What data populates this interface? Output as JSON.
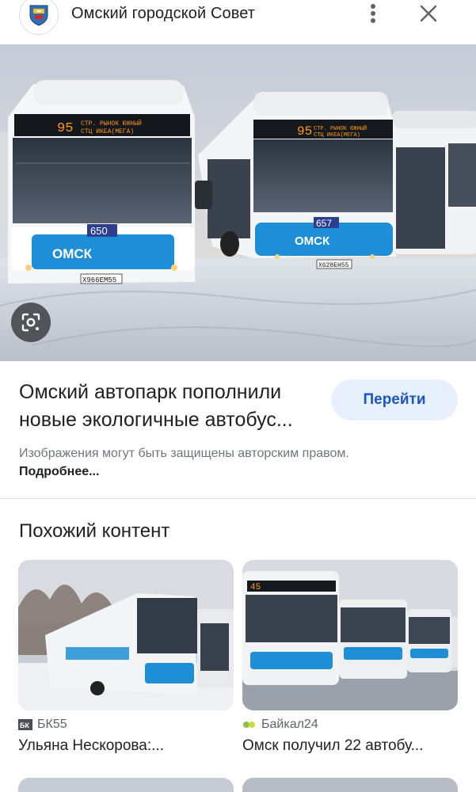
{
  "header": {
    "site_name": "Омский городской Совет",
    "favicon_icon": "omsk-coat-of-arms-icon",
    "menu_icon": "more-vert-icon",
    "close_icon": "close-icon"
  },
  "hero": {
    "lens_icon": "google-lens-icon",
    "bus_left": {
      "route": "95",
      "destination_line1": "СТР. РЫНОК ЮЖНЫЙ",
      "destination_line2": "СТЦ ИКЕА(МЕГА)",
      "fleet_number": "650",
      "plate": "Х966ЕМ55"
    },
    "bus_center": {
      "route": "95",
      "destination_line1": "СТР. РЫНОК ЮЖНЫЙ",
      "destination_line2": "СТЦ ИКЕА(МЕГА)",
      "fleet_number": "657",
      "plate": "Х628ЕН55"
    },
    "bus_brand": "ОМСК"
  },
  "article": {
    "headline_line1": "Омский автопарк пополнили",
    "headline_line2": "новые экологичные автобус...",
    "visit_button": "Перейти",
    "copyright_text": "Изображения могут быть защищены авторским правом.",
    "more_link": "Подробнее..."
  },
  "related": {
    "section_title": "Похожий контент",
    "cards": [
      {
        "source": "БК55",
        "source_badge": "БК",
        "title": "Ульяна Нескорова:..."
      },
      {
        "source": "Байкал24",
        "title": "Омск получил 22 автобу..."
      }
    ]
  },
  "colors": {
    "accent": "#1a56c4",
    "button_bg": "#e8f0fe",
    "bus_blue": "#1e8fd6",
    "led": "#ff9a1a"
  }
}
